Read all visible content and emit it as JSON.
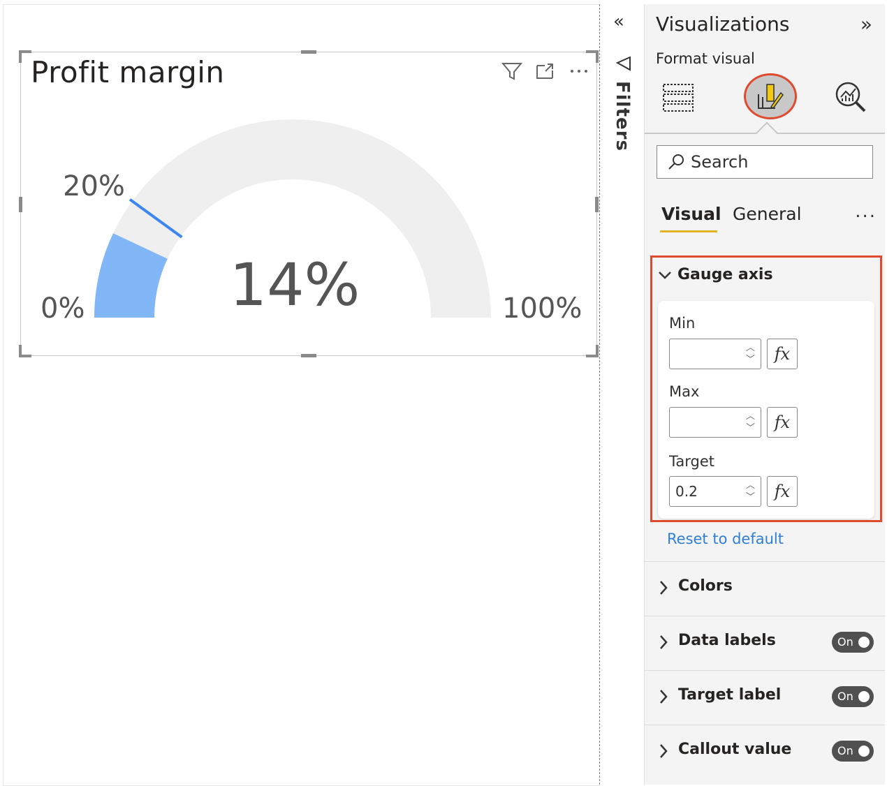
{
  "visual": {
    "title": "Profit margin",
    "header_icons": [
      "filter-icon",
      "focus-mode-icon",
      "more-options-icon"
    ],
    "gauge": {
      "value": 0.14,
      "min": 0,
      "max": 1,
      "target": 0.2,
      "callout": "14%",
      "min_label": "0%",
      "max_label": "100%",
      "target_label": "20%",
      "fill_color": "#82b7f7",
      "track_color": "#f0efef",
      "target_color": "#3c86f0"
    }
  },
  "filters_pane": {
    "label": "Filters",
    "collapse_glyph": "«"
  },
  "viz_pane": {
    "title": "Visualizations",
    "expand_glyph": "»",
    "subtitle": "Format visual",
    "icons": [
      "build-visual-icon",
      "format-visual-icon",
      "analytics-icon"
    ],
    "search": {
      "placeholder": "Search"
    },
    "tabs": {
      "visual": "Visual",
      "general": "General",
      "more": "..."
    },
    "gauge_axis": {
      "title": "Gauge axis",
      "min_label": "Min",
      "min_value": "",
      "max_label": "Max",
      "max_value": "",
      "target_label": "Target",
      "target_value": "0.2",
      "fx": "fx"
    },
    "reset": "Reset to default",
    "sections": [
      {
        "label": "Colors"
      },
      {
        "label": "Data labels",
        "toggle": "On"
      },
      {
        "label": "Target label",
        "toggle": "On"
      },
      {
        "label": "Callout value",
        "toggle": "On"
      }
    ]
  },
  "colors": {
    "accent_highlight": "#e04a2f",
    "tab_underline": "#e6b422",
    "link": "#2f7fd6"
  }
}
